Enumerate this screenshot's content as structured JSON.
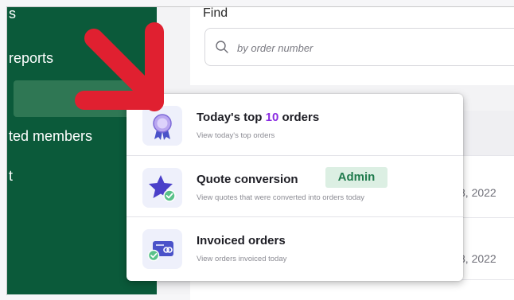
{
  "sidebar": {
    "items": [
      {
        "label": "s"
      },
      {
        "label": "reports"
      },
      {
        "label": ""
      },
      {
        "label": "ted members"
      },
      {
        "label": "t"
      }
    ]
  },
  "find": {
    "label": "Find",
    "placeholder": "by order number"
  },
  "table": {
    "dates": [
      "8, 2022",
      "8, 2022"
    ]
  },
  "menu": {
    "items": [
      {
        "title_before": "Today's top ",
        "title_highlight": "10",
        "title_after": " orders",
        "description": "View today's top orders",
        "icon": "award-ribbon-icon"
      },
      {
        "title": "Quote conversion",
        "badge": "Admin",
        "description": "View quotes that were converted into orders today",
        "icon": "star-check-icon"
      },
      {
        "title": "Invoiced orders",
        "description": "View orders invoiced today",
        "icon": "invoice-card-check-icon"
      }
    ]
  },
  "colors": {
    "sidebar": "#0b5a3a",
    "highlight": "#8a2be2",
    "badge_bg": "#dcefe3",
    "badge_text": "#1f7a4c",
    "arrow": "#e02030"
  }
}
